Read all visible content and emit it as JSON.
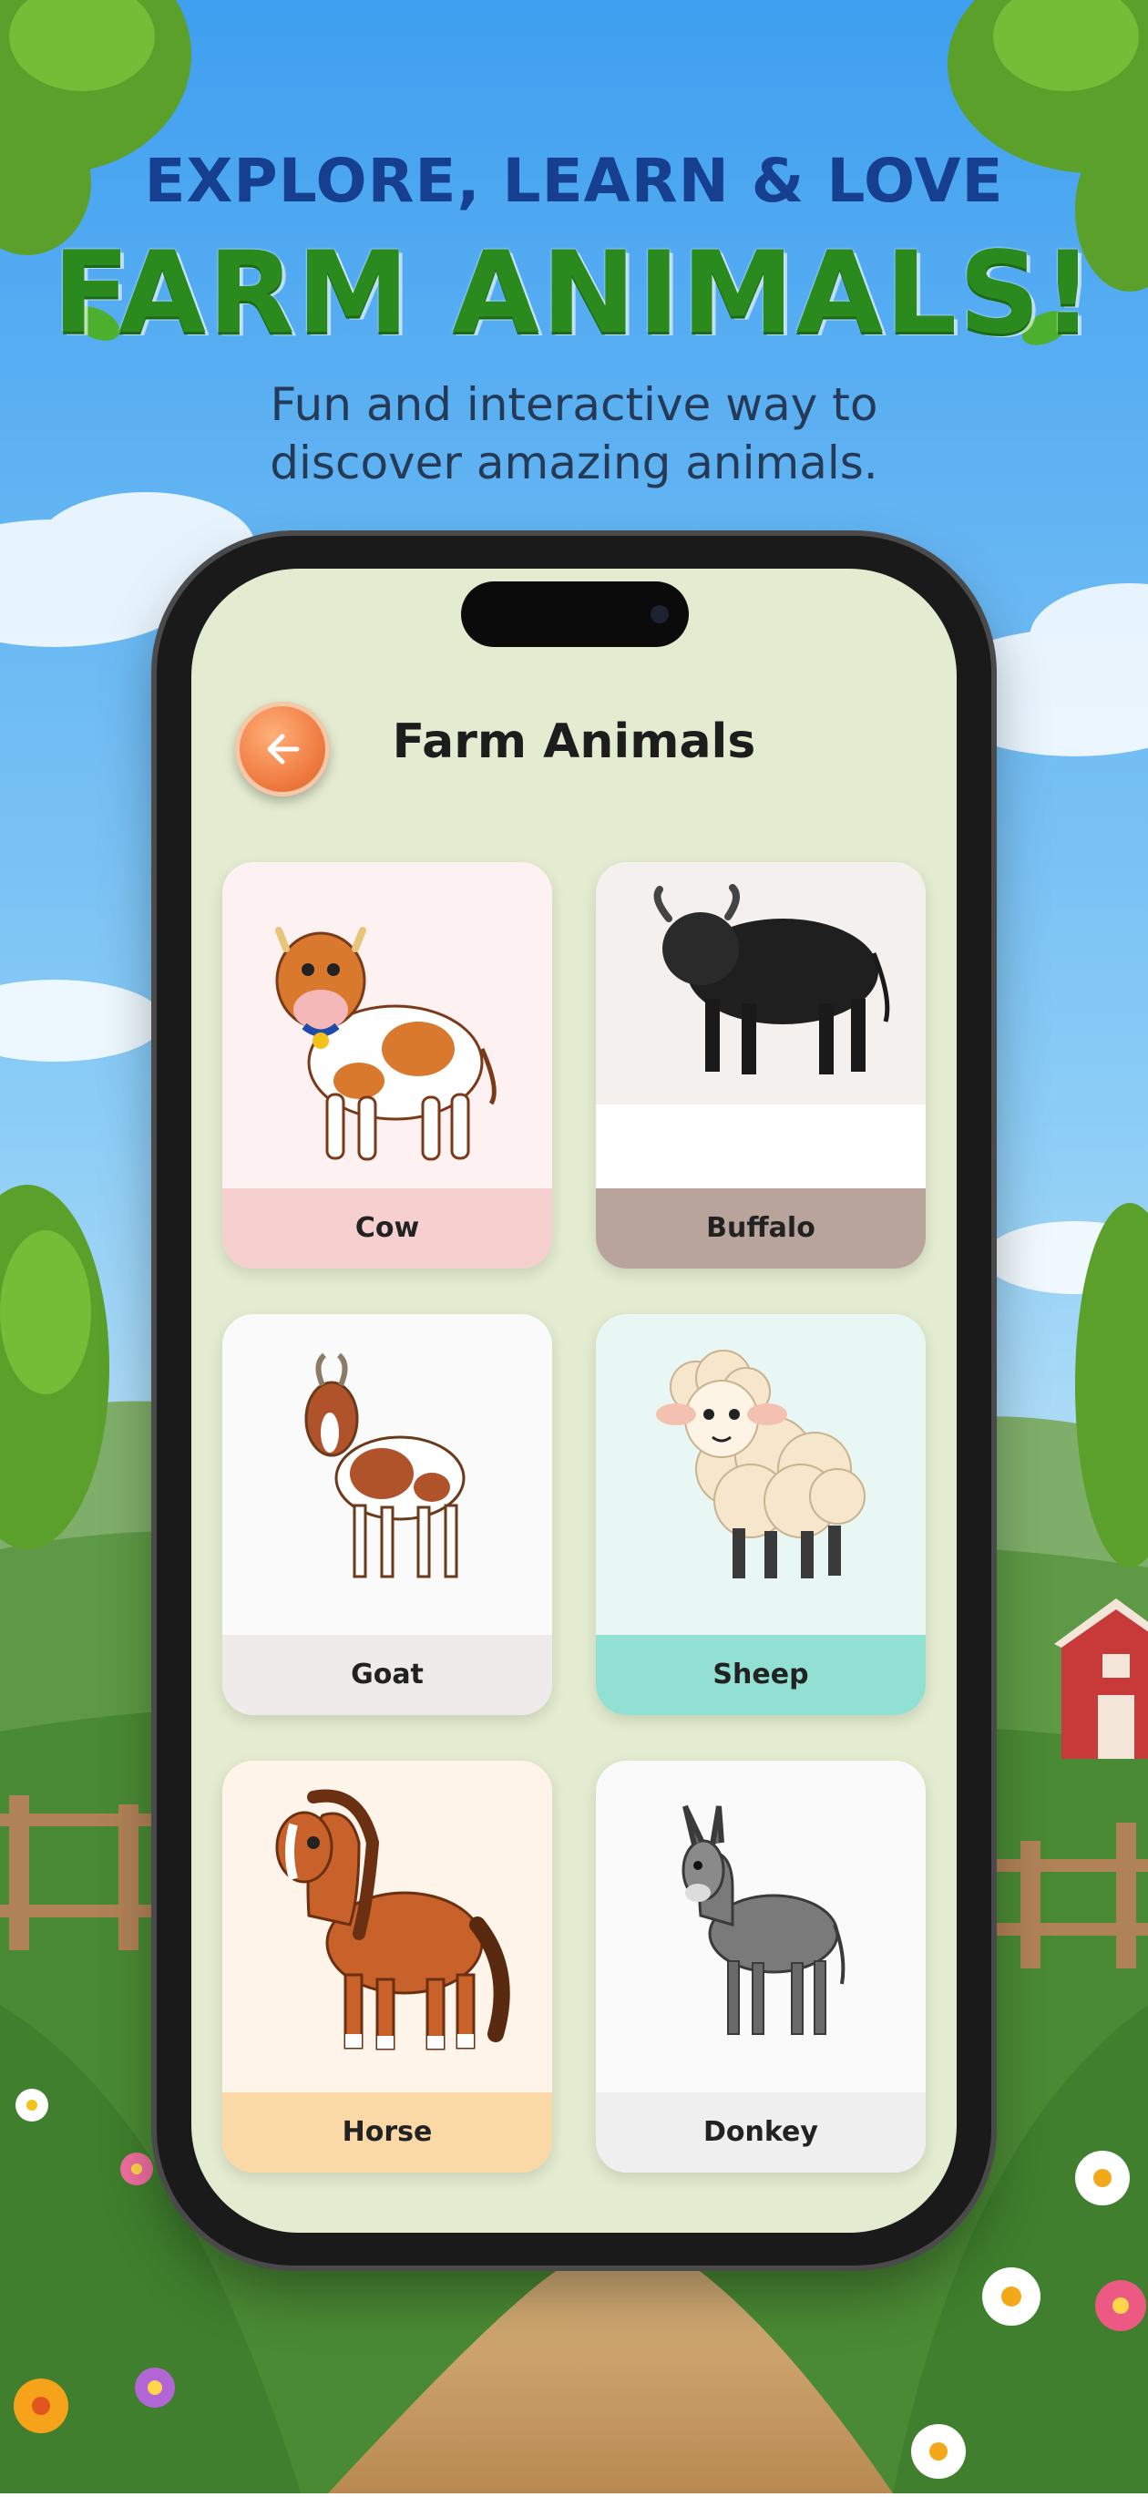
{
  "hero": {
    "kicker": "EXPLORE, LEARN & LOVE",
    "title": "FARM ANIMALS!",
    "subtitle_line1": "Fun and interactive way to",
    "subtitle_line2": "discover amazing animals."
  },
  "app": {
    "title": "Farm Animals",
    "back_icon": "arrow-left-icon",
    "accent": "#ef7a3f",
    "background": "#e3ecd0"
  },
  "animals": [
    {
      "name": "Cow",
      "card_color": "#fdf1f1",
      "label_color": "#f6cfcf"
    },
    {
      "name": "Buffalo",
      "card_color": "#f3f0ee",
      "label_color": "#b8a49a"
    },
    {
      "name": "Goat",
      "card_color": "#fafafa",
      "label_color": "#eeebea"
    },
    {
      "name": "Sheep",
      "card_color": "#e8f7f4",
      "label_color": "#92e0d3"
    },
    {
      "name": "Horse",
      "card_color": "#fff4ea",
      "label_color": "#fbd9a6"
    },
    {
      "name": "Donkey",
      "card_color": "#fafafa",
      "label_color": "#efefef"
    }
  ]
}
